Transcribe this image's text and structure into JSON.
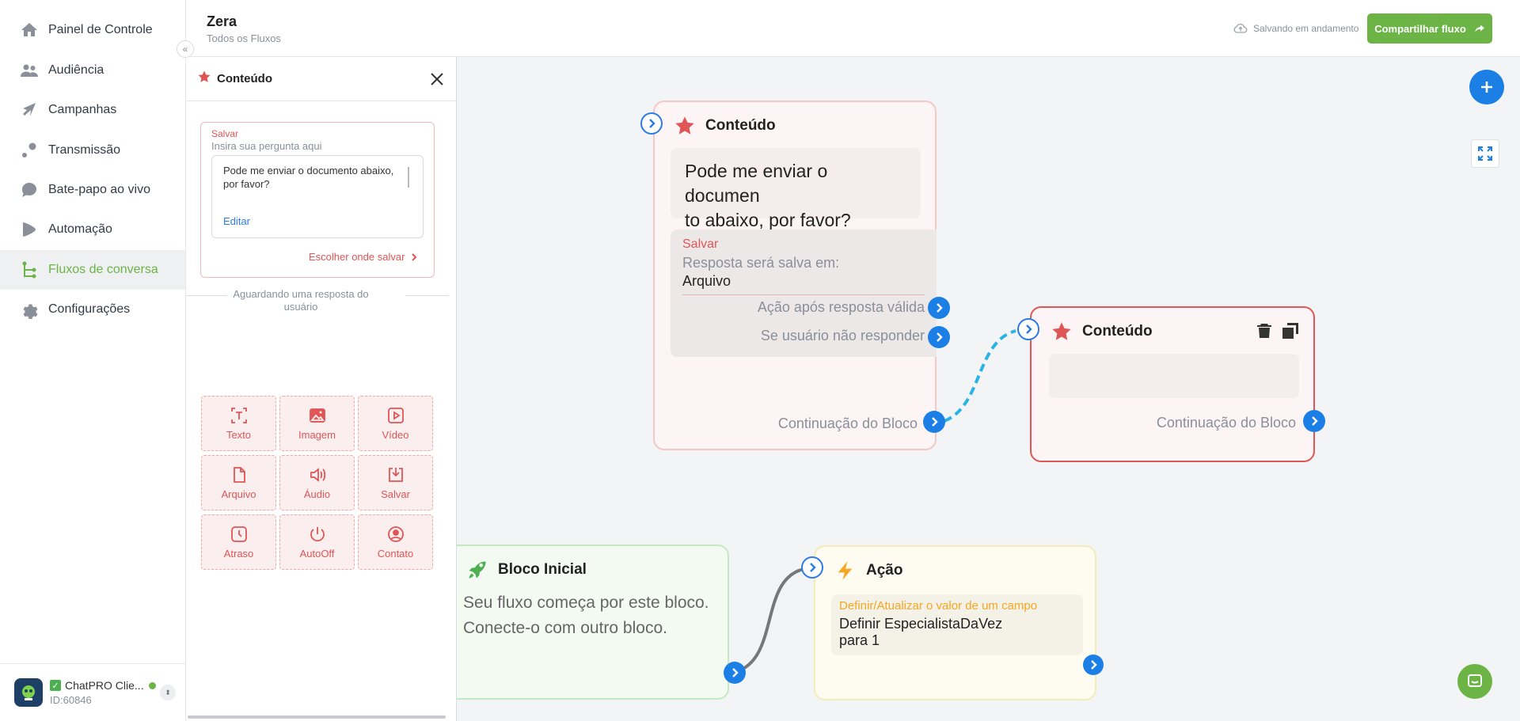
{
  "nav": {
    "items": [
      {
        "label": "Painel de Controle",
        "icon": "home-icon"
      },
      {
        "label": "Audiência",
        "icon": "users-icon"
      },
      {
        "label": "Campanhas",
        "icon": "campaign-icon"
      },
      {
        "label": "Transmissão",
        "icon": "broadcast-icon"
      },
      {
        "label": "Bate-papo ao vivo",
        "icon": "chat-bubble-icon"
      },
      {
        "label": "Automação",
        "icon": "automation-icon"
      },
      {
        "label": "Fluxos de conversa",
        "icon": "flow-icon"
      },
      {
        "label": "Configurações",
        "icon": "gear-icon"
      }
    ],
    "active_index": 6
  },
  "account": {
    "name": "ChatPRO Clie...",
    "id": "ID:60846",
    "status_color": "#6cb446"
  },
  "header": {
    "title": "Zera",
    "breadcrumb": "Todos os Fluxos",
    "save_status": "Salvando em andamento",
    "share_label": "Compartilhar fluxo"
  },
  "panel": {
    "title": "Conteúdo",
    "save_label": "Salvar",
    "question_placeholder": "Insira sua pergunta aqui",
    "question_text": "Pode me enviar o documento abaixo, por favor?",
    "edit_label": "Editar",
    "choose_save_label": "Escolher onde salvar",
    "waiting_label": "Aguardando uma resposta do usuário",
    "tools": [
      {
        "label": "Texto",
        "icon": "text-icon"
      },
      {
        "label": "Imagem",
        "icon": "image-icon"
      },
      {
        "label": "Vídeo",
        "icon": "video-icon"
      },
      {
        "label": "Arquivo",
        "icon": "file-icon"
      },
      {
        "label": "Áudio",
        "icon": "audio-icon"
      },
      {
        "label": "Salvar",
        "icon": "save-icon"
      },
      {
        "label": "Atraso",
        "icon": "delay-icon"
      },
      {
        "label": "AutoOff",
        "icon": "power-icon"
      },
      {
        "label": "Contato",
        "icon": "contact-icon"
      }
    ]
  },
  "canvas": {
    "content_node_1": {
      "title": "Conteúdo",
      "message_line1": "Pode me enviar o documen",
      "message_line2": "to abaixo, por favor?",
      "save_title": "Salvar",
      "save_desc": "Resposta será salva em:",
      "save_target": "Arquivo",
      "option_valid": "Ação após resposta válida",
      "option_no_reply": "Se usuário não responder",
      "continuation": "Continuação do Bloco"
    },
    "content_node_2": {
      "title": "Conteúdo",
      "continuation": "Continuação do Bloco"
    },
    "start_node": {
      "title": "Bloco Inicial",
      "desc_line1": "Seu fluxo começa por este bloco.",
      "desc_line2": "Conecte-o com outro bloco."
    },
    "action_node": {
      "title": "Ação",
      "action_title": "Definir/Atualizar o valor de um campo",
      "action_line1": "Definir EspecialistaDaVez",
      "action_line2": "para 1"
    }
  },
  "colors": {
    "brand_green": "#6cb446",
    "accent_blue": "#1c7fe6",
    "content_red": "#e05555",
    "action_yellow": "#f5a623"
  }
}
